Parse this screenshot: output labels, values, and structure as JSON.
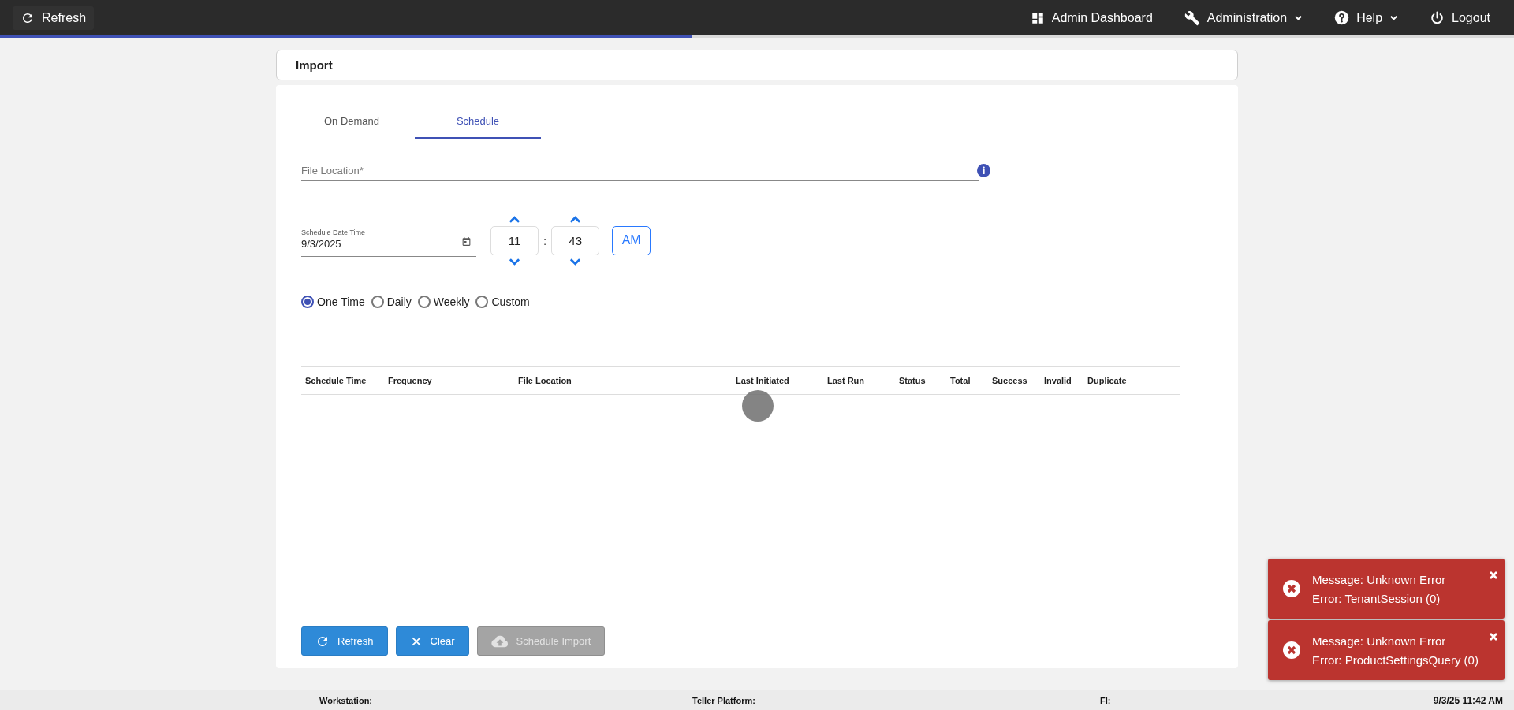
{
  "topbar": {
    "refresh": "Refresh",
    "menu": [
      {
        "label": "Admin Dashboard",
        "dropdown": false
      },
      {
        "label": "Administration",
        "dropdown": true
      },
      {
        "label": "Help",
        "dropdown": true
      },
      {
        "label": "Logout",
        "dropdown": false
      }
    ]
  },
  "progress": {
    "level": 0.457
  },
  "panel": {
    "title": "Import"
  },
  "tabs": [
    {
      "label": "On Demand",
      "selected": false
    },
    {
      "label": "Schedule",
      "selected": true
    }
  ],
  "file_location": {
    "placeholder": "File Location*"
  },
  "schedule_date": {
    "label": "Schedule Date Time",
    "value": "9/3/2025"
  },
  "time": {
    "hour": "11",
    "separator": ":",
    "minute": "43",
    "period": "AM"
  },
  "frequency": [
    {
      "label": "One Time",
      "selected": true
    },
    {
      "label": "Daily",
      "selected": false
    },
    {
      "label": "Weekly",
      "selected": false
    },
    {
      "label": "Custom",
      "selected": false
    }
  ],
  "table": {
    "columns": [
      "Schedule Time",
      "Frequency",
      "File Location",
      "Last Initiated",
      "Last Run",
      "Status",
      "Total",
      "Success",
      "Invalid",
      "Duplicate"
    ],
    "loading": true
  },
  "buttons": [
    {
      "label": "Refresh",
      "disabled": false
    },
    {
      "label": "Clear",
      "disabled": false
    },
    {
      "label": "Schedule Import",
      "disabled": true
    }
  ],
  "toasts": [
    {
      "message": "Message: Unknown Error",
      "error": "Error: TenantSession (0)"
    },
    {
      "message": "Message: Unknown Error",
      "error": "Error: ProductSettingsQuery (0)"
    }
  ],
  "status_bar": {
    "workstation": "Workstation:",
    "teller_platform": "Teller Platform:",
    "fi": "FI:",
    "datetime": "9/3/25 11:42 AM"
  }
}
